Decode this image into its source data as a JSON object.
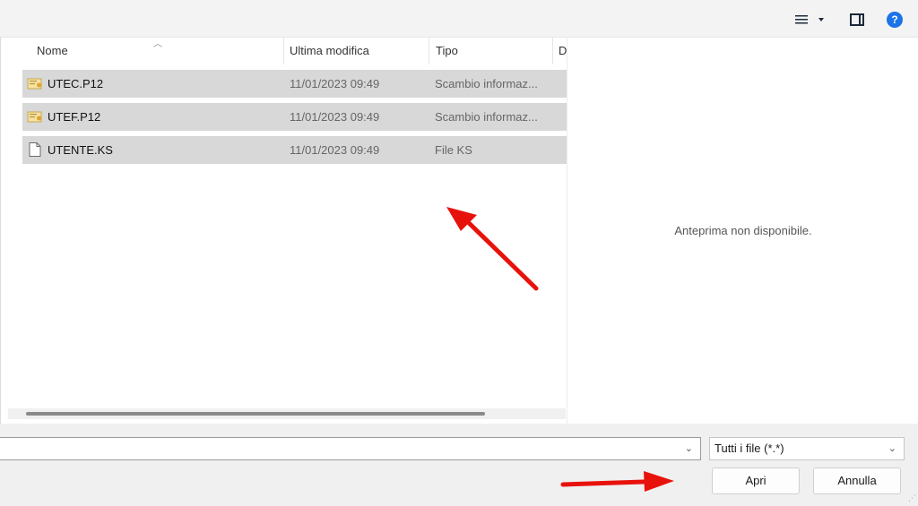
{
  "columns": {
    "name": "Nome",
    "modified": "Ultima modifica",
    "type": "Tipo",
    "size": "D"
  },
  "files": [
    {
      "name": "UTEC.P12",
      "modified": "11/01/2023 09:49",
      "type": "Scambio informaz...",
      "icon": "certificate-icon"
    },
    {
      "name": "UTEF.P12",
      "modified": "11/01/2023 09:49",
      "type": "Scambio informaz...",
      "icon": "certificate-icon"
    },
    {
      "name": "UTENTE.KS",
      "modified": "11/01/2023 09:49",
      "type": "File KS",
      "icon": "file-icon"
    }
  ],
  "preview": {
    "message": "Anteprima non disponibile."
  },
  "toolbar": {
    "view_icon": "view-list-icon",
    "preview_icon": "preview-pane-icon",
    "help_label": "?"
  },
  "footer": {
    "filename_value": "",
    "filter_value": "Tutti i file (*.*)",
    "open_label": "Apri",
    "cancel_label": "Annulla"
  },
  "colors": {
    "selection": "#d8d8d8",
    "accent": "#1a73e8",
    "arrow": "#e8120c"
  }
}
